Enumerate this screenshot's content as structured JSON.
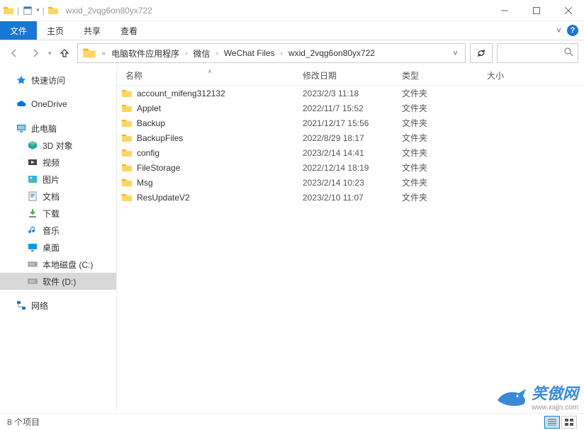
{
  "window": {
    "title": "wxid_2vqg6on80yx722"
  },
  "ribbon": {
    "file": "文件",
    "tabs": [
      "主页",
      "共享",
      "查看"
    ]
  },
  "breadcrumb": {
    "items": [
      "电脑软件应用程序",
      "微信",
      "WeChat Files",
      "wxid_2vqg6on80yx722"
    ]
  },
  "search": {
    "placeholder": ""
  },
  "sidebar": {
    "quick_access": "快速访问",
    "onedrive": "OneDrive",
    "this_pc": "此电脑",
    "pc_children": [
      {
        "label": "3D 对象",
        "icon": "3d"
      },
      {
        "label": "视频",
        "icon": "video"
      },
      {
        "label": "图片",
        "icon": "pic"
      },
      {
        "label": "文档",
        "icon": "doc"
      },
      {
        "label": "下载",
        "icon": "download"
      },
      {
        "label": "音乐",
        "icon": "music"
      },
      {
        "label": "桌面",
        "icon": "desktop"
      },
      {
        "label": "本地磁盘 (C:)",
        "icon": "disk"
      },
      {
        "label": "软件 (D:)",
        "icon": "disk",
        "selected": true
      }
    ],
    "network": "网络"
  },
  "columns": {
    "name": "名称",
    "date": "修改日期",
    "type": "类型",
    "size": "大小"
  },
  "rows": [
    {
      "name": "account_mifeng312132",
      "date": "2023/2/3 11:18",
      "type": "文件夹"
    },
    {
      "name": "Applet",
      "date": "2022/11/7 15:52",
      "type": "文件夹"
    },
    {
      "name": "Backup",
      "date": "2021/12/17 15:56",
      "type": "文件夹"
    },
    {
      "name": "BackupFiles",
      "date": "2022/8/29 18:17",
      "type": "文件夹"
    },
    {
      "name": "config",
      "date": "2023/2/14 14:41",
      "type": "文件夹"
    },
    {
      "name": "FileStorage",
      "date": "2022/12/14 18:19",
      "type": "文件夹"
    },
    {
      "name": "Msg",
      "date": "2023/2/14 10:23",
      "type": "文件夹"
    },
    {
      "name": "ResUpdateV2",
      "date": "2023/2/10 11:07",
      "type": "文件夹"
    }
  ],
  "status": {
    "count_label": "8 个项目"
  },
  "watermark": {
    "text": "笑傲网",
    "sub": "www.xajjn.com"
  }
}
